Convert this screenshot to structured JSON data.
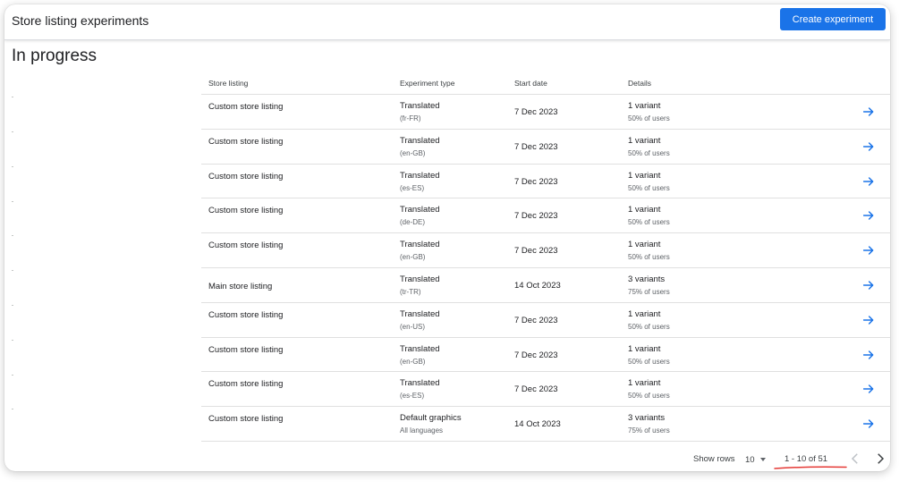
{
  "header": {
    "title": "Store listing experiments",
    "create_button": "Create experiment"
  },
  "section": {
    "title": "In progress"
  },
  "table": {
    "columns": [
      "Store listing",
      "Experiment type",
      "Start date",
      "Details"
    ],
    "rows": [
      {
        "listing": "Custom store listing",
        "type": "Translated",
        "type_sub": "(fr-FR)",
        "date": "7 Dec 2023",
        "variants": "1 variant",
        "users": "50% of users"
      },
      {
        "listing": "Custom store listing",
        "type": "Translated",
        "type_sub": "(en-GB)",
        "date": "7 Dec 2023",
        "variants": "1 variant",
        "users": "50% of users"
      },
      {
        "listing": "Custom store listing",
        "type": "Translated",
        "type_sub": "(es-ES)",
        "date": "7 Dec 2023",
        "variants": "1 variant",
        "users": "50% of users"
      },
      {
        "listing": "Custom store listing",
        "type": "Translated",
        "type_sub": "(de-DE)",
        "date": "7 Dec 2023",
        "variants": "1 variant",
        "users": "50% of users"
      },
      {
        "listing": "Custom store listing",
        "type": "Translated",
        "type_sub": "(en-GB)",
        "date": "7 Dec 2023",
        "variants": "1 variant",
        "users": "50% of users"
      },
      {
        "listing": "Main store listing",
        "type": "Translated",
        "type_sub": "(tr-TR)",
        "date": "14 Oct 2023",
        "variants": "3 variants",
        "users": "75% of users"
      },
      {
        "listing": "Custom store listing",
        "type": "Translated",
        "type_sub": "(en-US)",
        "date": "7 Dec 2023",
        "variants": "1 variant",
        "users": "50% of users"
      },
      {
        "listing": "Custom store listing",
        "type": "Translated",
        "type_sub": "(en-GB)",
        "date": "7 Dec 2023",
        "variants": "1 variant",
        "users": "50% of users"
      },
      {
        "listing": "Custom store listing",
        "type": "Translated",
        "type_sub": "(es-ES)",
        "date": "7 Dec 2023",
        "variants": "1 variant",
        "users": "50% of users"
      },
      {
        "listing": "Custom store listing",
        "type": "Default graphics",
        "type_sub": "All languages",
        "date": "14 Oct 2023",
        "variants": "3 variants",
        "users": "75% of users"
      }
    ]
  },
  "pagination": {
    "show_rows_label": "Show rows",
    "rows_value": "10",
    "range": "1 - 10 of 51"
  },
  "icons": {
    "row_action": "arrow-forward-icon",
    "prev": "chevron-left-icon",
    "next": "chevron-right-icon",
    "dropdown": "caret-down-icon"
  },
  "colors": {
    "accent": "#1a73e8",
    "annotation": "#e53935"
  }
}
